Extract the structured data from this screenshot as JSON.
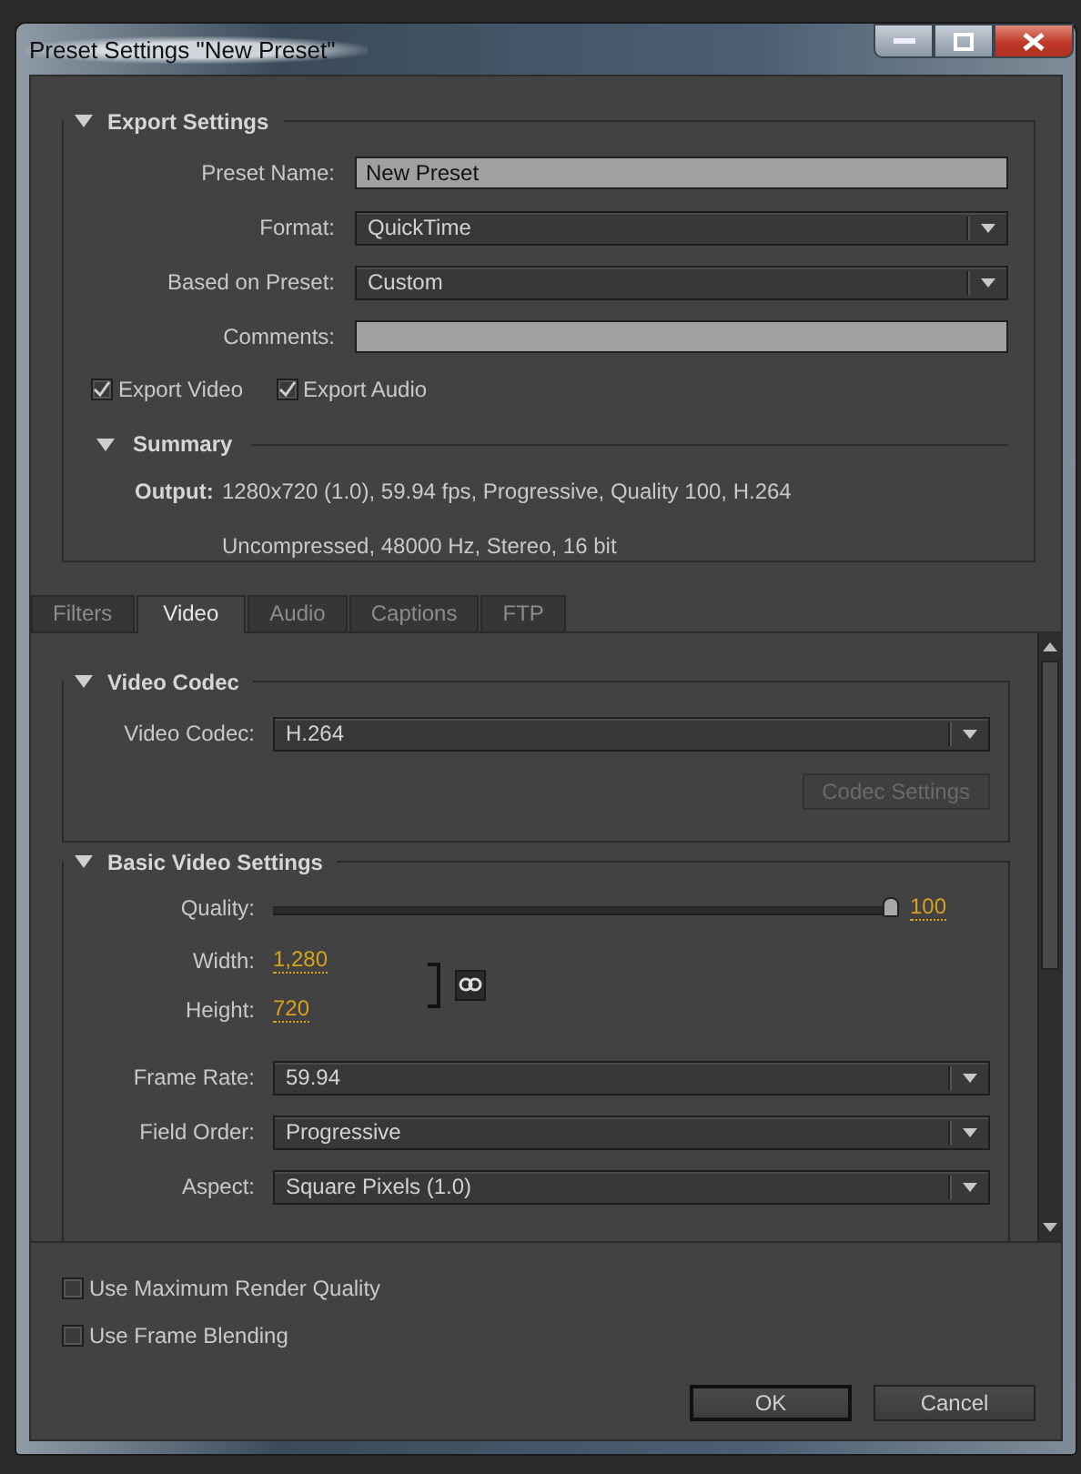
{
  "window": {
    "title": "Preset Settings \"New Preset\""
  },
  "export_settings": {
    "title": "Export Settings",
    "expanded": true,
    "fields": [
      {
        "kind": "text",
        "label": "Preset Name:",
        "value": "New Preset"
      },
      {
        "kind": "dropdown",
        "label": "Format:",
        "value": "QuickTime"
      },
      {
        "kind": "dropdown",
        "label": "Based on Preset:",
        "value": "Custom"
      },
      {
        "kind": "text",
        "label": "Comments:"
      }
    ],
    "checkboxes": [
      {
        "label": "Export Video",
        "checked": true
      },
      {
        "label": "Export Audio",
        "checked": true
      }
    ],
    "summary": {
      "title": "Summary",
      "expanded": true,
      "output_label": "Output:",
      "lines": [
        "1280x720 (1.0), 59.94 fps, Progressive, Quality 100, H.264",
        "Uncompressed, 48000 Hz, Stereo, 16 bit"
      ]
    }
  },
  "tabs": [
    {
      "label": "Filters",
      "selected": false
    },
    {
      "label": "Video",
      "selected": true
    },
    {
      "label": "Audio",
      "selected": false
    },
    {
      "label": "Captions",
      "selected": false
    },
    {
      "label": "FTP",
      "selected": false
    }
  ],
  "video_codec": {
    "title": "Video Codec",
    "expanded": true,
    "label": "Video Codec:",
    "value": "H.264",
    "button": {
      "label": "Codec Settings",
      "disabled": true
    }
  },
  "basic_video": {
    "title": "Basic Video Settings",
    "expanded": true,
    "quality": {
      "label": "Quality:",
      "level": 1,
      "reading": "100"
    },
    "width": {
      "label": "Width:",
      "value": "1,280"
    },
    "height": {
      "label": "Height:",
      "value": "720"
    },
    "dropdowns": [
      {
        "label": "Frame Rate:",
        "value": "59.94"
      },
      {
        "label": "Field Order:",
        "value": "Progressive"
      },
      {
        "label": "Aspect:",
        "value": "Square Pixels (1.0)"
      }
    ]
  },
  "options": [
    {
      "label": "Use Maximum Render Quality",
      "checked": false
    },
    {
      "label": "Use Frame Blending",
      "checked": false
    }
  ],
  "buttons": [
    {
      "label": "OK",
      "default": true
    },
    {
      "label": "Cancel",
      "default": false
    }
  ]
}
